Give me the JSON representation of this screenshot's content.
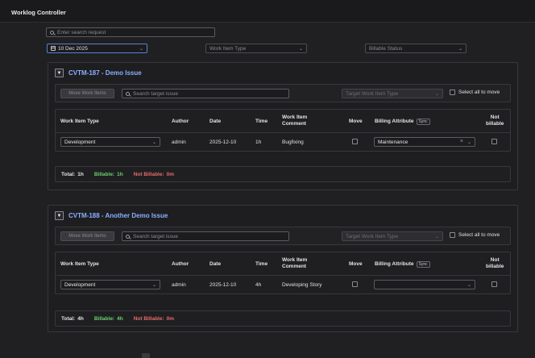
{
  "app": {
    "title": "Worklog Controller"
  },
  "filters": {
    "search_placeholder": "Enter search request",
    "date_value": "10 Dec 2025",
    "work_item_type_placeholder": "Work Item Type",
    "billable_status_placeholder": "Billable Status"
  },
  "columns": {
    "work_item_type": "Work Item Type",
    "author": "Author",
    "date": "Date",
    "time": "Time",
    "comment_line1": "Work Item",
    "comment_line2": "Comment",
    "move": "Move",
    "billing_attribute": "Billing Attribute",
    "sync": "Sync",
    "not_billable_line1": "Not",
    "not_billable_line2": "billable"
  },
  "toolbar": {
    "move_button": "Move Work Items",
    "target_search_placeholder": "Search target issue",
    "target_type_placeholder": "Target Work Item Type",
    "select_all": "Select all to move"
  },
  "totals_labels": {
    "total": "Total:",
    "billable": "Billable:",
    "not_billable": "Not Billable:"
  },
  "issues": [
    {
      "toggle": "▼",
      "title": "CVTM-187 - Demo Issue",
      "row": {
        "work_item_type": "Development",
        "author": "admin",
        "date": "2025-12-10",
        "time": "1h",
        "comment": "Bugfixing",
        "billing_attribute": "Maintenance",
        "move_checked": false,
        "not_billable_checked": false
      },
      "totals": {
        "total": "1h",
        "billable": "1h",
        "not_billable": "0m"
      }
    },
    {
      "toggle": "▼",
      "title": "CVTM-188 - Another Demo Issue",
      "row": {
        "work_item_type": "Development",
        "author": "admin",
        "date": "2025-12-10",
        "time": "4h",
        "comment": "Developing Story",
        "billing_attribute": "",
        "move_checked": false,
        "not_billable_checked": false
      },
      "totals": {
        "total": "4h",
        "billable": "4h",
        "not_billable": "0m"
      }
    }
  ],
  "colors": {
    "accent": "#8ab0ff",
    "billable": "#6ccf6c",
    "not_billable": "#e86a6a",
    "background": "#202022"
  },
  "icons": {
    "search": "search-icon",
    "calendar": "calendar-icon",
    "chevron": "chevron-down-icon",
    "clear": "close-icon",
    "collapse": "collapse-toggle-icon"
  }
}
